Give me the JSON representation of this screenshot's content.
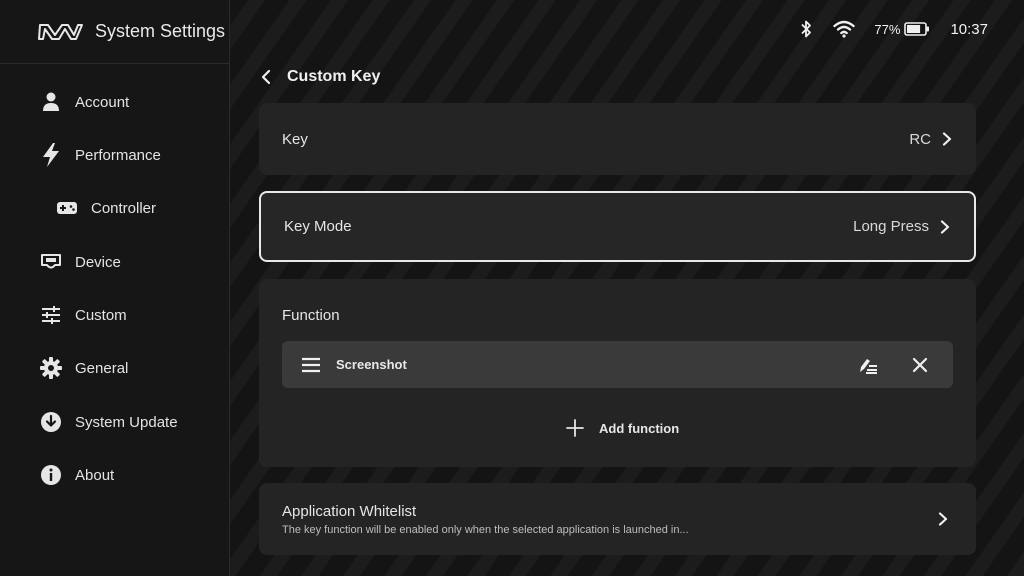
{
  "sidebar": {
    "title": "System Settings",
    "logo": "brand-logo",
    "items": [
      {
        "label": "Account",
        "icon": "person-icon"
      },
      {
        "label": "Performance",
        "icon": "lightning-icon"
      },
      {
        "label": "Controller",
        "icon": "gamepad-icon"
      },
      {
        "label": "Device",
        "icon": "handheld-device-icon"
      },
      {
        "label": "Custom",
        "icon": "sliders-icon"
      },
      {
        "label": "General",
        "icon": "gear-icon"
      },
      {
        "label": "System Update",
        "icon": "download-circle-icon"
      },
      {
        "label": "About",
        "icon": "info-icon"
      }
    ]
  },
  "status_bar": {
    "battery_percent": "77%",
    "battery_level": 0.77,
    "time": "10:37",
    "icons": [
      "bluetooth-icon",
      "wifi-icon",
      "battery-icon"
    ]
  },
  "header": {
    "title": "Custom Key",
    "back_icon": "chevron-left-icon"
  },
  "key_row": {
    "label": "Key",
    "value": "RC"
  },
  "key_mode_row": {
    "label": "Key Mode",
    "value": "Long Press"
  },
  "function_section": {
    "title": "Function",
    "items": [
      {
        "name": "Screenshot",
        "drag_icon": "drag-handle-icon",
        "edit_icon": "edit-icon",
        "remove_icon": "close-icon"
      }
    ],
    "add_label": "Add function"
  },
  "whitelist": {
    "title": "Application Whitelist",
    "description": "The key function will be enabled only when the selected application is launched in..."
  },
  "colors": {
    "background": "#141414",
    "card": "#242424",
    "item": "#3a3a3a",
    "focus_border": "#e8e8e8",
    "text": "#e6e6e6"
  }
}
